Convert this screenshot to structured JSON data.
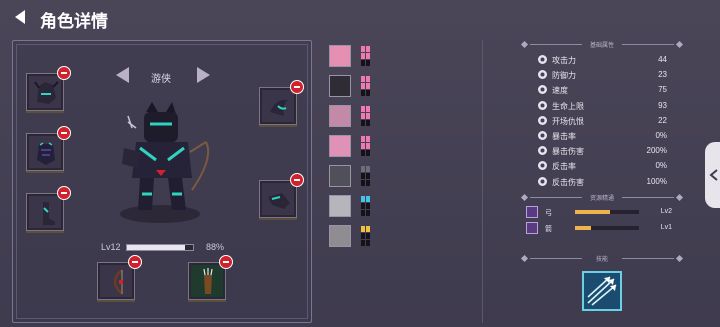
{
  "header": {
    "title": "角色详情"
  },
  "hero": {
    "class_name": "游侠",
    "level_label": "Lv12",
    "xp_percent_label": "88%",
    "xp_fraction": 0.88
  },
  "equipment": {
    "slots": [
      {
        "name": "helmet-slot",
        "icon": "helmet-icon"
      },
      {
        "name": "armor-slot",
        "icon": "chestplate-icon"
      },
      {
        "name": "boots-slot",
        "icon": "boots-icon"
      },
      {
        "name": "shoulder-slot",
        "icon": "horn-icon"
      },
      {
        "name": "gloves-slot",
        "icon": "gauntlet-icon"
      },
      {
        "name": "bow-slot",
        "icon": "bow-icon"
      },
      {
        "name": "quiver-slot",
        "icon": "quiver-icon"
      }
    ]
  },
  "skills": [
    {
      "icon": "pink-gem-icon",
      "pips": "pink"
    },
    {
      "icon": "dark-crest-icon",
      "pips": "pink"
    },
    {
      "icon": "claw-slash-icon",
      "pips": "pink"
    },
    {
      "icon": "arrow-strike-icon",
      "pips": "pink"
    },
    {
      "icon": "bow-shot-icon",
      "pips": "gray"
    },
    {
      "icon": "wind-icon",
      "pips": "cyan"
    },
    {
      "icon": "hunter-face-icon",
      "pips": "yellow"
    }
  ],
  "stats": {
    "section_title": "基础属性",
    "rows": [
      {
        "label": "攻击力",
        "value": "44",
        "icon": "sword-icon"
      },
      {
        "label": "防御力",
        "value": "23",
        "icon": "shield-icon"
      },
      {
        "label": "速度",
        "value": "75",
        "icon": "boot-icon"
      },
      {
        "label": "生命上限",
        "value": "93",
        "icon": "heart-icon"
      },
      {
        "label": "开场仇恨",
        "value": "22",
        "icon": "skull-icon"
      },
      {
        "label": "暴击率",
        "value": "0%",
        "icon": "crit-icon"
      },
      {
        "label": "暴击伤害",
        "value": "200%",
        "icon": "crit-damage-icon"
      },
      {
        "label": "反击率",
        "value": "0%",
        "icon": "counter-icon"
      },
      {
        "label": "反击伤害",
        "value": "100%",
        "icon": "counter-damage-icon"
      }
    ]
  },
  "resources": {
    "section_title": "资源精通",
    "rows": [
      {
        "label": "弓",
        "level": "Lv2",
        "fraction": 0.55
      },
      {
        "label": "箭",
        "level": "Lv1",
        "fraction": 0.25
      }
    ]
  },
  "skill_section": {
    "title": "技能",
    "icon": "multi-arrow-icon"
  },
  "colors": {
    "accent": "#f0b24a",
    "badge": "#d2212c",
    "cyan": "#6ad0e6"
  }
}
